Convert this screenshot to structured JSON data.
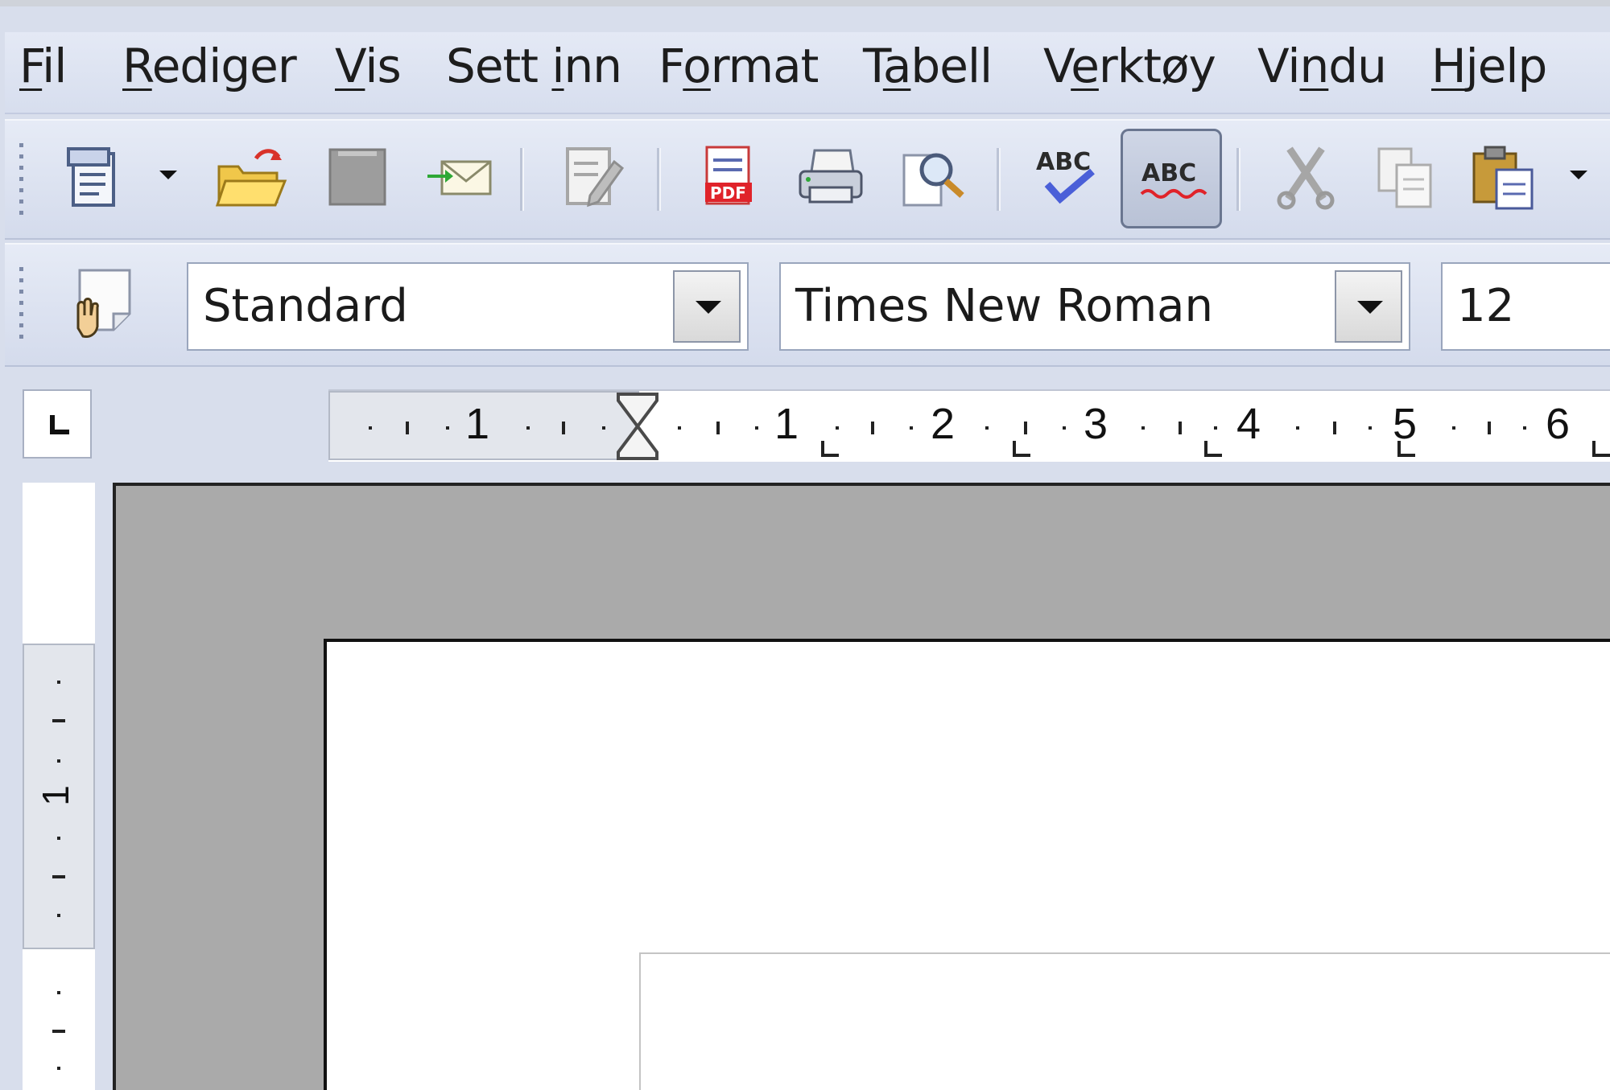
{
  "menu": {
    "items": [
      {
        "pre": "",
        "key": "F",
        "post": "il"
      },
      {
        "pre": "",
        "key": "R",
        "post": "ediger"
      },
      {
        "pre": "",
        "key": "V",
        "post": "is"
      },
      {
        "pre": "Sett ",
        "key": "i",
        "post": "nn"
      },
      {
        "pre": "F",
        "key": "o",
        "post": "rmat"
      },
      {
        "pre": "T",
        "key": "a",
        "post": "bell"
      },
      {
        "pre": "V",
        "key": "e",
        "post": "rktøy"
      },
      {
        "pre": "Vi",
        "key": "n",
        "post": "du"
      },
      {
        "pre": "",
        "key": "H",
        "post": "jelp"
      }
    ]
  },
  "toolbar": {
    "icons": [
      "new-document-icon",
      "open-folder-icon",
      "save-icon",
      "email-icon",
      "edit-file-icon",
      "export-pdf-icon",
      "print-icon",
      "page-preview-icon",
      "spellcheck-icon",
      "autospellcheck-icon",
      "cut-icon",
      "copy-icon",
      "paste-icon"
    ]
  },
  "formatting": {
    "style_value": "Standard",
    "font_value": "Times New Roman",
    "size_value": "12"
  },
  "ruler": {
    "labels": [
      "1",
      "1",
      "2",
      "3",
      "4",
      "5",
      "6"
    ],
    "vertical_label": "1"
  },
  "colors": {
    "menubar": "#dde3f1",
    "toolbar": "#d8deec",
    "document_background": "#aaaaaa",
    "page": "#ffffff"
  }
}
